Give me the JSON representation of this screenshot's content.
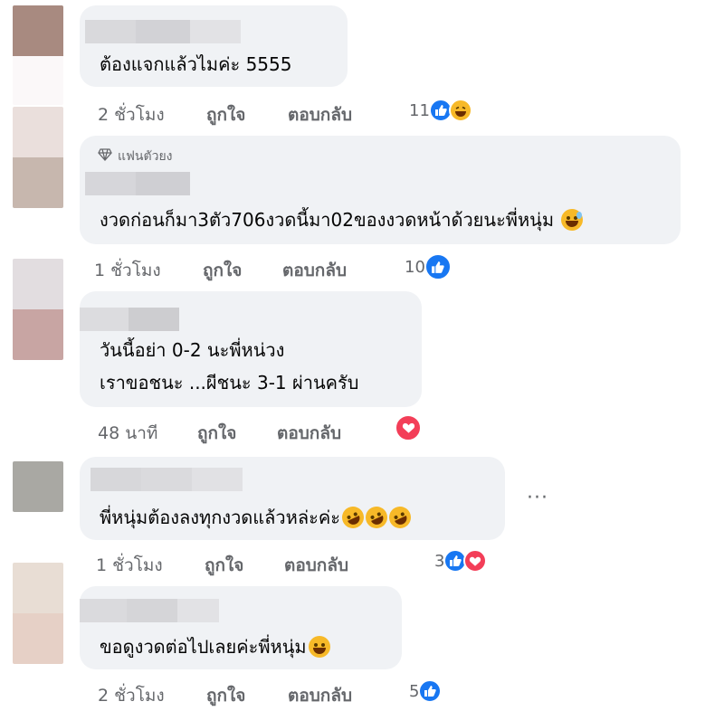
{
  "comments": [
    {
      "text": "ต้องแจกแล้วไมค่ะ 5555",
      "time": "2 ชั่วโมง",
      "like": "ถูกใจ",
      "reply": "ตอบกลับ",
      "reaction_count": "11",
      "reactions": [
        "like-icon",
        "haha-icon"
      ]
    },
    {
      "badge": "แฟนตัวยง",
      "text": "งวดก่อนก็มา3ตัว706งวดนี้มา02ของงวดหน้าด้วยนะพี่หนุ่ม",
      "time": "1 ชั่วโมง",
      "like": "ถูกใจ",
      "reply": "ตอบกลับ",
      "reaction_count": "10",
      "reactions": [
        "like-icon"
      ]
    },
    {
      "text_line1": "วันนี้อย่า 0-2 นะพี่หน่วง",
      "text_line2": "เราขอชนะ ...ผีชนะ 3-1 ผ่านครับ",
      "time": "48 นาที",
      "like": "ถูกใจ",
      "reply": "ตอบกลับ",
      "reactions": [
        "love-icon"
      ]
    },
    {
      "text": "พี่หนุ่มต้องลงทุกงวดแล้วหล่ะค่ะ",
      "time": "1 ชั่วโมง",
      "like": "ถูกใจ",
      "reply": "ตอบกลับ",
      "reaction_count": "3",
      "reactions": [
        "like-icon",
        "love-icon"
      ],
      "more": "···"
    },
    {
      "text": "ขอดูงวดต่อไปเลยค่ะพี่หนุ่ม",
      "time": "2 ชั่วโมง",
      "like": "ถูกใจ",
      "reply": "ตอบกลับ",
      "reaction_count": "5",
      "reactions": [
        "like-icon"
      ]
    }
  ],
  "colors": {
    "bubble": "#f0f2f5",
    "meta_text": "#65676b",
    "like_blue": "#1877f2",
    "love_red": "#f33e58",
    "haha_yellow": "#f7b928"
  }
}
